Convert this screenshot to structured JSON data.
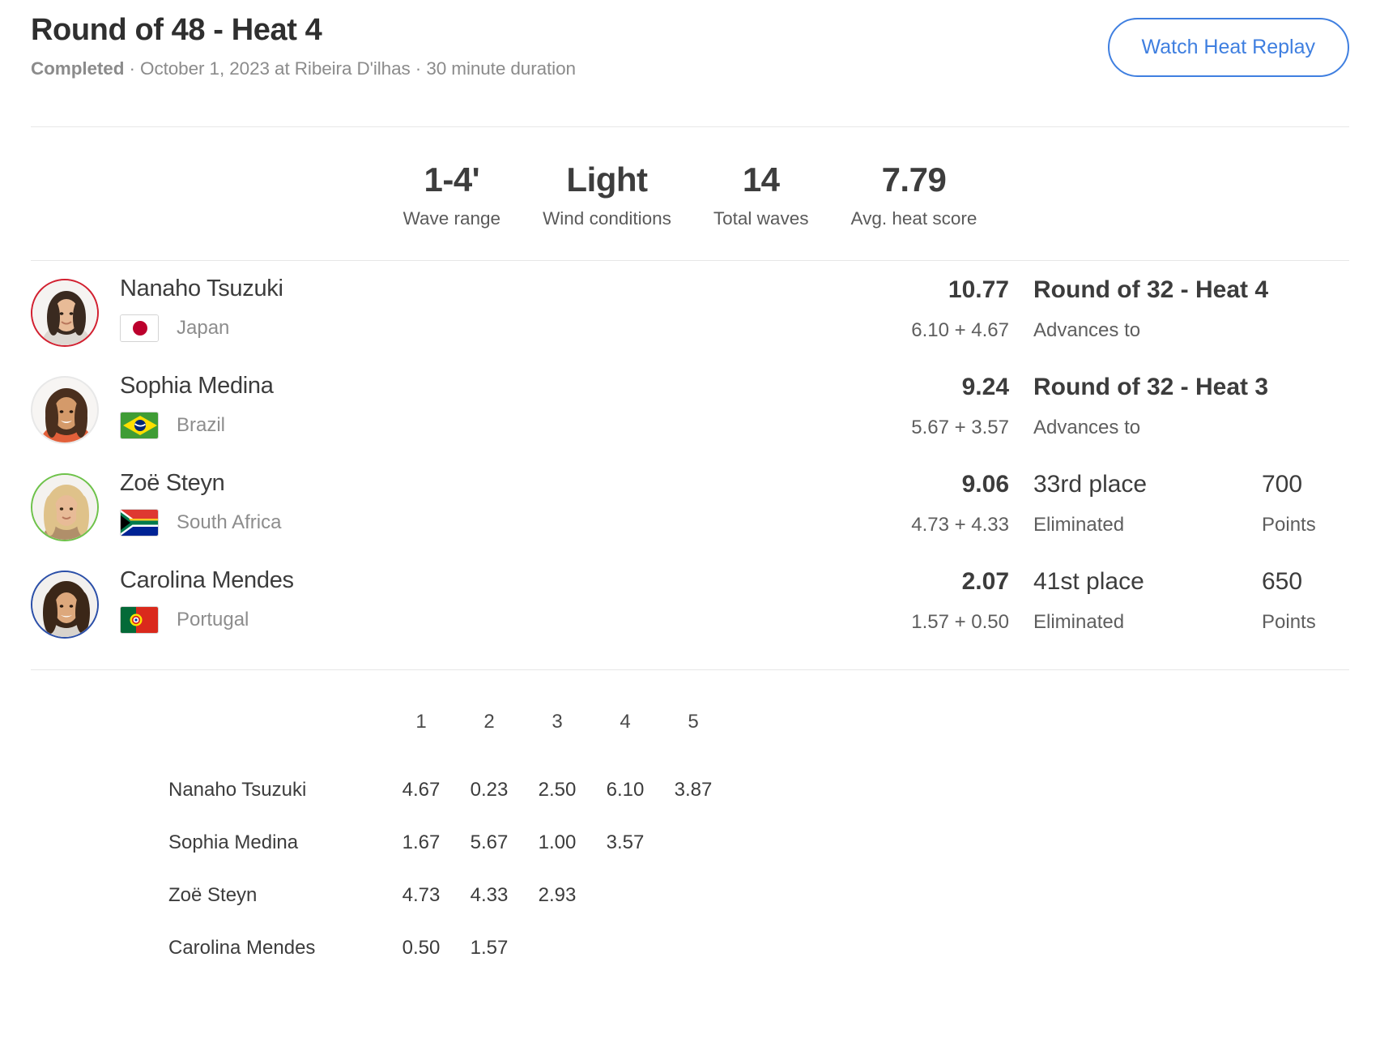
{
  "header": {
    "title": "Round of 48 - Heat 4",
    "status": "Completed",
    "meta": " · October 1, 2023 at Ribeira D'ilhas · 30 minute duration",
    "replay_button": "Watch Heat Replay",
    "accent_color": "#3f7fe0"
  },
  "stats": [
    {
      "value": "1-4'",
      "label": "Wave range"
    },
    {
      "value": "Light",
      "label": "Wind conditions"
    },
    {
      "value": "14",
      "label": "Total waves"
    },
    {
      "value": "7.79",
      "label": "Avg. heat score"
    }
  ],
  "athletes": [
    {
      "name": "Nanaho Tsuzuki",
      "nationality": "Japan",
      "flag": "jp",
      "ring_color": "#d22030",
      "total": "10.77",
      "parts": "6.10 + 4.67",
      "result": "Round of 32 - Heat 4",
      "result_bold": true,
      "result_sub": "Advances to",
      "points": "",
      "points_label": ""
    },
    {
      "name": "Sophia Medina",
      "nationality": "Brazil",
      "flag": "br",
      "ring_color": "#e8e8e8",
      "total": "9.24",
      "parts": "5.67 + 3.57",
      "result": "Round of 32 - Heat 3",
      "result_bold": true,
      "result_sub": "Advances to",
      "points": "",
      "points_label": ""
    },
    {
      "name": "Zoë Steyn",
      "nationality": "South Africa",
      "flag": "za",
      "ring_color": "#6ec24a",
      "total": "9.06",
      "parts": "4.73 + 4.33",
      "result": "33rd place",
      "result_bold": false,
      "result_sub": "Eliminated",
      "points": "700",
      "points_label": "Points"
    },
    {
      "name": "Carolina Mendes",
      "nationality": "Portugal",
      "flag": "pt",
      "ring_color": "#2b4fa8",
      "total": "2.07",
      "parts": "1.57 + 0.50",
      "result": "41st place",
      "result_bold": false,
      "result_sub": "Eliminated",
      "points": "650",
      "points_label": "Points"
    }
  ],
  "wave_table": {
    "columns": [
      "1",
      "2",
      "3",
      "4",
      "5"
    ],
    "counted_color": "#f2a52c",
    "rows": [
      {
        "name": "Nanaho Tsuzuki",
        "scores": [
          {
            "value": "4.67",
            "counted": true
          },
          {
            "value": "0.23",
            "counted": false
          },
          {
            "value": "2.50",
            "counted": false
          },
          {
            "value": "6.10",
            "counted": true
          },
          {
            "value": "3.87",
            "counted": false
          }
        ]
      },
      {
        "name": "Sophia Medina",
        "scores": [
          {
            "value": "1.67",
            "counted": false
          },
          {
            "value": "5.67",
            "counted": true
          },
          {
            "value": "1.00",
            "counted": false
          },
          {
            "value": "3.57",
            "counted": true
          }
        ]
      },
      {
        "name": "Zoë Steyn",
        "scores": [
          {
            "value": "4.73",
            "counted": true
          },
          {
            "value": "4.33",
            "counted": true
          },
          {
            "value": "2.93",
            "counted": false
          }
        ]
      },
      {
        "name": "Carolina Mendes",
        "scores": [
          {
            "value": "0.50",
            "counted": true
          },
          {
            "value": "1.57",
            "counted": true
          }
        ]
      }
    ]
  }
}
